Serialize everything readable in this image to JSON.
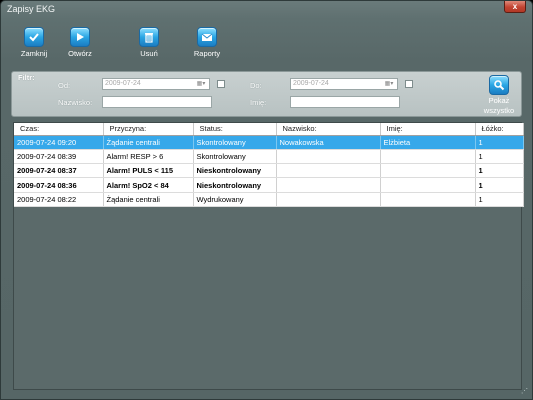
{
  "window": {
    "title": "Zapisy EKG",
    "close_glyph": "x"
  },
  "toolbar": [
    {
      "name": "close-record-button",
      "label": "Zamknij",
      "icon": "checkmark-icon"
    },
    {
      "name": "open-button",
      "label": "Otwórz",
      "icon": "play-icon"
    },
    {
      "name": "delete-button",
      "label": "Usuń",
      "icon": "trash-icon"
    },
    {
      "name": "reports-button",
      "label": "Raporty",
      "icon": "envelope-icon"
    }
  ],
  "filter": {
    "title": "Filtr:",
    "from_label": "Od:",
    "from_value": "2009-07-24",
    "to_label": "Do:",
    "to_value": "2009-07-24",
    "surname_label": "Nazwisko:",
    "surname_value": "",
    "name_label": "Imię:",
    "name_value": "",
    "show_all_line1": "Pokaż",
    "show_all_line2": "wszystko",
    "show_all_icon": "magnifier-icon"
  },
  "table": {
    "columns": [
      "Czas:",
      "Przyczyna:",
      "Status:",
      "Nazwisko:",
      "Imię:",
      "Łóżko:"
    ],
    "rows": [
      {
        "cells": [
          "2009-07-24 09:20",
          "Żądanie centrali",
          "Skontrolowany",
          "Nowakowska",
          "Elżbieta",
          "1"
        ],
        "selected": true,
        "bold": false
      },
      {
        "cells": [
          "2009-07-24 08:39",
          "Alarm! RESP > 6",
          "Skontrolowany",
          "",
          "",
          "1"
        ],
        "selected": false,
        "bold": false
      },
      {
        "cells": [
          "2009-07-24 08:37",
          "Alarm! PULS < 115",
          "Nieskontrolowany",
          "",
          "",
          "1"
        ],
        "selected": false,
        "bold": true
      },
      {
        "cells": [
          "2009-07-24 08:36",
          "Alarm! SpO2 < 84",
          "Nieskontrolowany",
          "",
          "",
          "1"
        ],
        "selected": false,
        "bold": true
      },
      {
        "cells": [
          "2009-07-24 08:22",
          "Żądanie centrali",
          "Wydrukowany",
          "",
          "",
          "1"
        ],
        "selected": false,
        "bold": false
      }
    ]
  },
  "colors": {
    "selection": "#36a8ea",
    "window_bg": "#5b6b6b",
    "accent_icon": "#2aa6e4"
  }
}
